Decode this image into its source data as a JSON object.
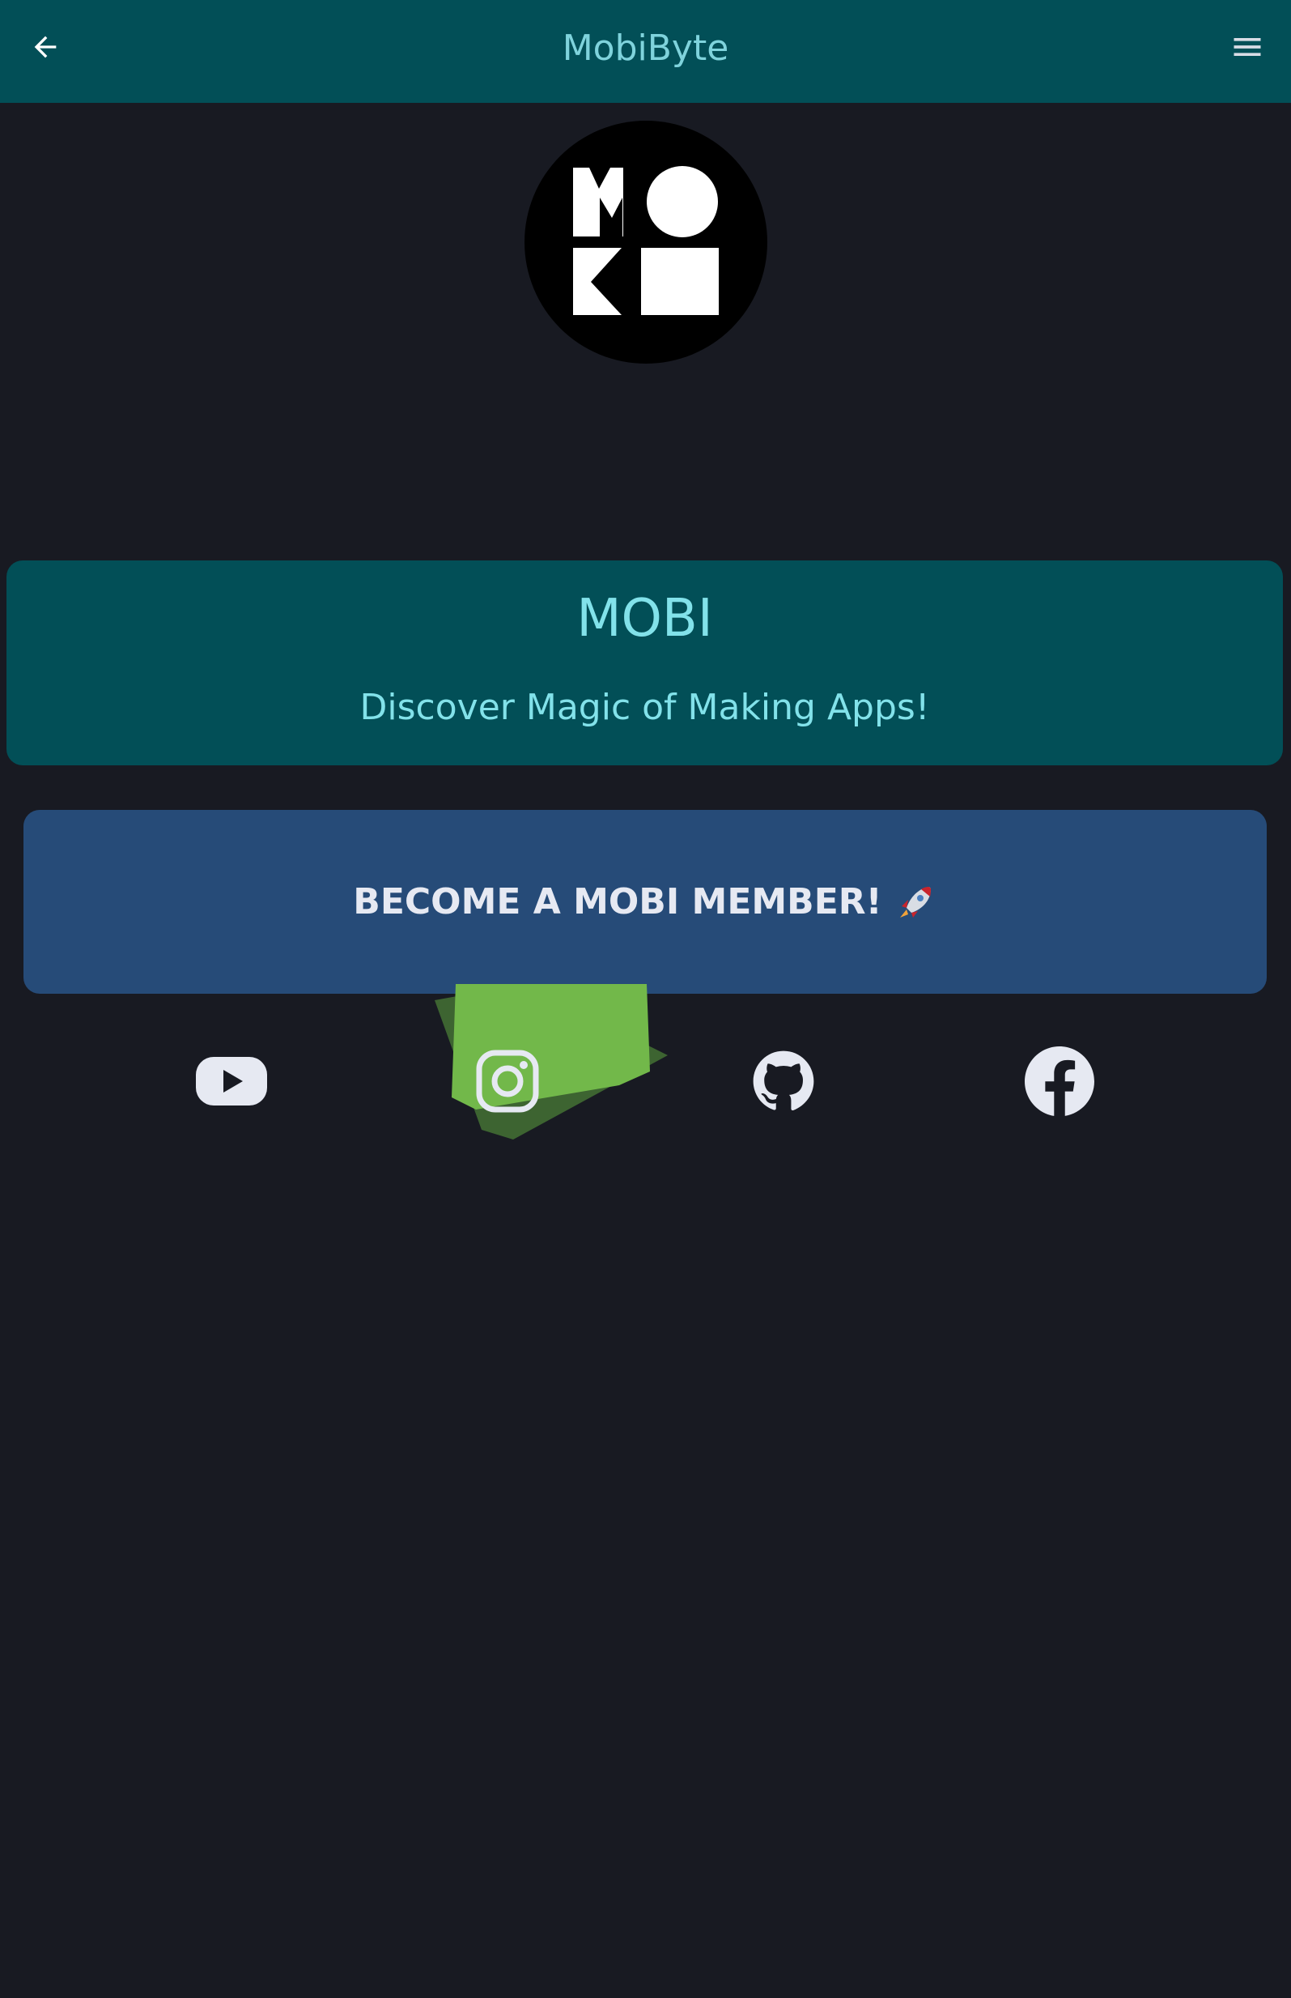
{
  "appbar": {
    "title": "MobiByte",
    "back_icon": "arrow-left-icon",
    "menu_icon": "hamburger-menu-icon"
  },
  "logo": {
    "letters": "MOKB"
  },
  "info_card": {
    "title": "MOBI",
    "subtitle": "Discover Magic of Making Apps!"
  },
  "member_button": {
    "label": "BECOME A MOBI MEMBER!",
    "emoji_icon": "rocket-icon"
  },
  "social_links": [
    {
      "name": "youtube",
      "icon": "youtube-icon"
    },
    {
      "name": "instagram",
      "icon": "instagram-icon",
      "highlighted": true
    },
    {
      "name": "github",
      "icon": "github-icon"
    },
    {
      "name": "facebook",
      "icon": "facebook-icon"
    }
  ],
  "colors": {
    "background": "#181a22",
    "appbar": "#024f57",
    "accent_text": "#82e2ea",
    "button": "#264b78",
    "highlight_green": "#72b84a",
    "icon_fill": "#e6e9f2"
  }
}
